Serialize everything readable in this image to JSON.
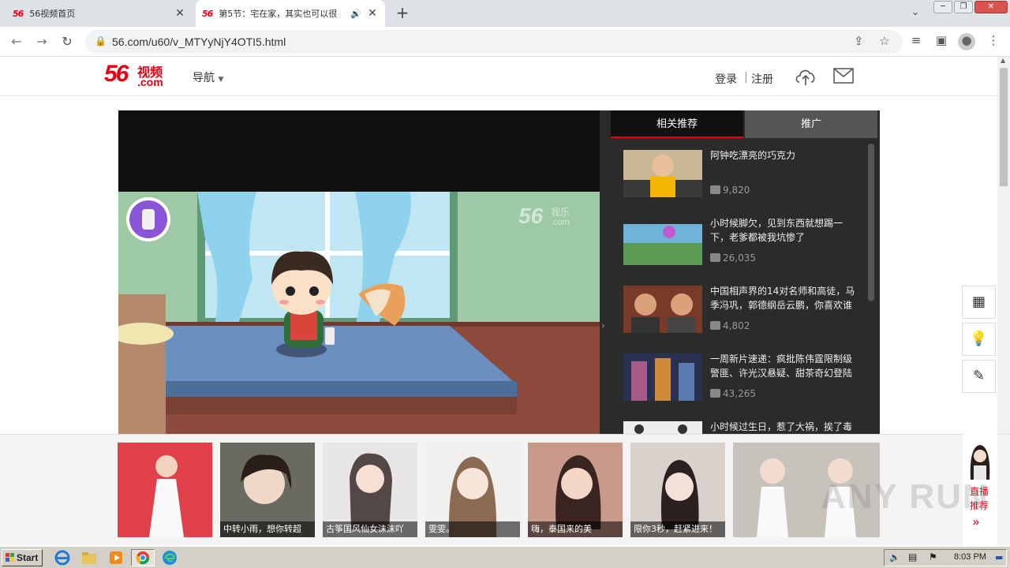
{
  "browser": {
    "tabs": [
      {
        "favicon": "56",
        "title": "56视频首页"
      },
      {
        "favicon": "56",
        "title": "第5节：宅在家，其实也可以很"
      }
    ],
    "new_tab": "+",
    "url": "56.com/u60/v_MTYyNjY4OTI5.html"
  },
  "site": {
    "logo_number": "56",
    "logo_cn": "视频",
    "logo_dotcom": ".com",
    "nav_label": "导航",
    "login": "登录",
    "register": "注册"
  },
  "player": {
    "watermark_main": "56",
    "watermark_sub": "我乐",
    "watermark_dotcom": ".com"
  },
  "panel": {
    "tabs": [
      "相关推荐",
      "推广"
    ],
    "items": [
      {
        "title": "阿钟吃漂亮的巧克力",
        "views": "9,820"
      },
      {
        "title": "小时候脚欠，见到东西就想踢一下，老爹都被我坑惨了",
        "views": "26,035"
      },
      {
        "title": "中国相声界的14对名师和高徒，马季冯巩，郭德纲岳云鹏，你喜欢谁",
        "views": "4,802"
      },
      {
        "title": "一周新片速递：疯批陈伟霆限制级警匪、许光汉悬疑、甜茶奇幻登陆",
        "views": "43,265"
      },
      {
        "title": "小时候过生日，惹了大祸，挨了毒",
        "views": ""
      }
    ]
  },
  "bottom": {
    "cards": [
      {
        "caption": ""
      },
      {
        "caption": "中转小雨，想你转超"
      },
      {
        "caption": "古筝国风仙女沫沫吖"
      },
      {
        "caption": "雯雯。"
      },
      {
        "caption": "嗨，泰国来的美"
      },
      {
        "caption": "限你3秒，赶紧进来！"
      },
      {
        "caption": ""
      }
    ],
    "live_label_1": "直播",
    "live_label_2": "推荐",
    "live_arrow": "»"
  },
  "watermark": "ANY RUN",
  "taskbar": {
    "start": "Start",
    "clock": "8:03 PM"
  },
  "colors": {
    "brand": "#e60012",
    "panel_bg": "#2b2b2b"
  }
}
